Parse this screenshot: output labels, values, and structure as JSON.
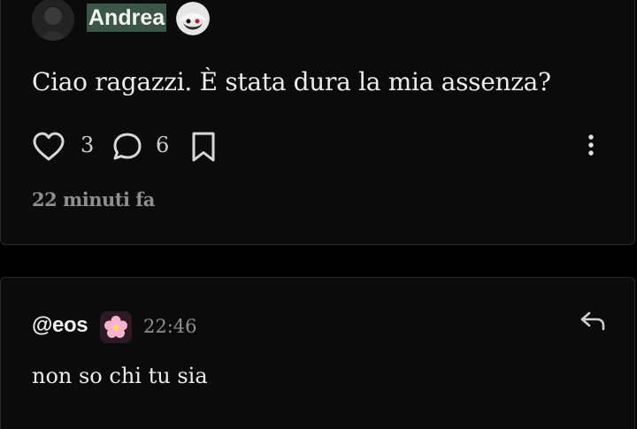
{
  "post": {
    "author": "Andrea",
    "text": "Ciao ragazzi. È stata dura la mia assenza?",
    "likes": "3",
    "comments": "6",
    "time_ago": "22 minuti fa"
  },
  "comment": {
    "author": "@eos",
    "time": "22:46",
    "text": "non so chi tu sia"
  },
  "icons": {
    "like": "heart-outline-icon",
    "comment": "speech-bubble-icon",
    "bookmark": "bookmark-outline-icon",
    "more": "vertical-dots-icon",
    "reply": "reply-arrow-icon",
    "comment_badge": "pink-flower-icon"
  },
  "colors": {
    "background": "#000000",
    "card": "#0b0b0b",
    "username_highlight": "#3b5546",
    "muted_text": "#8f8f8f",
    "flower": "#f6b3cf"
  }
}
